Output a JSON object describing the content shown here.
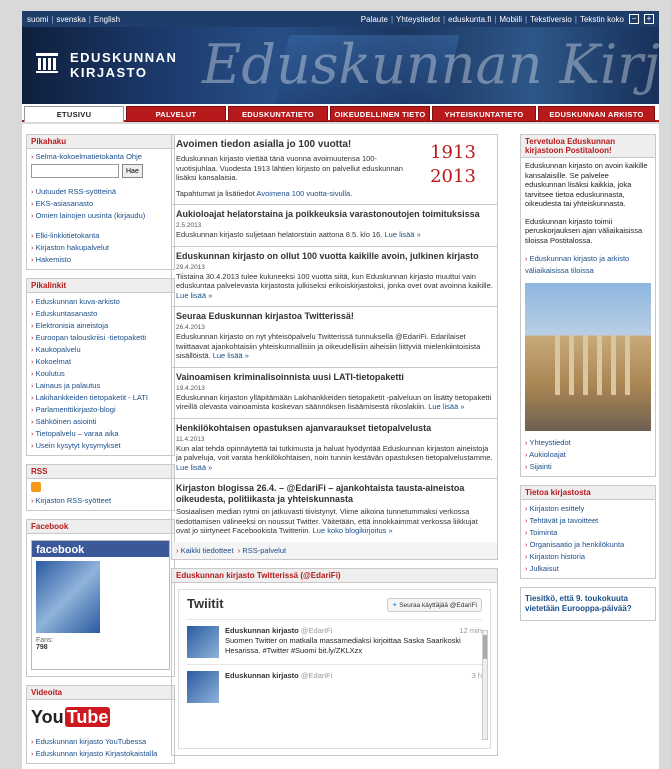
{
  "topbar": {
    "lang": [
      "suomi",
      "svenska",
      "English"
    ],
    "util": [
      "Palaute",
      "Yhteystiedot",
      "eduskunta.fi",
      "Mobiili",
      "Tekstiversio"
    ],
    "zoom_label": "Tekstin koko",
    "zoom_minus": "−",
    "zoom_plus": "+"
  },
  "banner": {
    "logo_line1": "EDUSKUNNAN",
    "logo_line2": "KIRJASTO",
    "script": "Eduskunnan Kirjasto"
  },
  "nav": [
    "ETUSIVU",
    "PALVELUT",
    "EDUSKUNTATIETO",
    "OIKEUDELLINEN TIETO",
    "YHTEISKUNTATIETO",
    "EDUSKUNNAN ARKISTO"
  ],
  "left": {
    "pikahaku": {
      "title": "Pikahaku",
      "link1": "Selma-kokoelmatietokanta",
      "link2": "Ohje",
      "button": "Hae",
      "links_a": [
        "Uutuudet RSS-syötteinä",
        "EKS-asiasanasto",
        "Omien lainojen uusinta (kirjaudu)"
      ],
      "links_b": [
        "Elki-linkkitietokanta",
        "Kirjaston hakupalvelut",
        "Hakemisto"
      ]
    },
    "pikalinkit": {
      "title": "Pikalinkit",
      "links": [
        "Eduskunnan kuva-arkisto",
        "Eduskuntasanasto",
        "Elektronisia aineistoja",
        "Euroopan talouskriisi -tietopaketti",
        "Kaukopalvelu",
        "Kokoelmat",
        "Koulutus",
        "Lainaus ja palautus",
        "Lakihankkeiden tietopaketit - LATI",
        "Parlamenttikirjasto-blogi",
        "Sähköinen asiointi",
        "Tietopalvelu – varaa aika",
        "Usein kysytyt kysymykset"
      ]
    },
    "rss": {
      "title": "RSS",
      "link": "Kirjaston RSS-syötteet"
    },
    "facebook": {
      "title": "Facebook",
      "brand": "facebook",
      "fans_label": "Fans",
      "fans": "798"
    },
    "videoita": {
      "title": "Videoita",
      "yt1": "You",
      "yt2": "Tube",
      "links": [
        "Eduskunnan kirjasto YouTubessa",
        "Eduskunnan kirjasto Kirjastokaistalla"
      ]
    }
  },
  "center": {
    "feature": {
      "title": "Avoimen tiedon asialla jo 100 vuotta!",
      "text": "Eduskunnan kirjasto viettää tänä vuonna avoimuutensa 100-vuotisjuhlaa. Vuodesta 1913 lähtien kirjasto on palvellut eduskunnan lisäksi kansalaisia.",
      "text2": "Tapahtumat ja lisätiedot",
      "link": "Avoimena 100 vuotta-sivulla",
      "year1": "1913",
      "year2": "2013"
    },
    "news": [
      {
        "title": "Aukioloajat helatorstaina ja poikkeuksia varastonoutojen toimituksissa",
        "date": "2.5.2013",
        "text": "Eduskunnan kirjasto suljetaan helatorstain aattona 8.5. klo 16.",
        "more": "Lue lisää »"
      },
      {
        "title": "Eduskunnan kirjasto on ollut 100 vuotta kaikille avoin, julkinen kirjasto",
        "date": "29.4.2013",
        "text": "Tiistaina 30.4.2013 tulee kuluneeksi 100 vuotta siitä, kun Eduskunnan kirjasto muuttui vain eduskuntaa palvelevasta kirjastosta julkiseksi erikoiskirjastoksi, jonka ovet ovat avoinna kaikille.",
        "more": "Lue lisää »"
      },
      {
        "title": "Seuraa Eduskunnan kirjastoa Twitterissä!",
        "date": "26.4.2013",
        "text": "Eduskunnan kirjasto on nyt yhteisöpalvelu Twitterissä tunnuksella @EdariFi. Edarilaiset twiittaavat ajankohtaisiin yhteiskunnallisiin ja oikeudellisiin aiheisiin liittyviä mielenkiintoisista sisällöistä.",
        "more": "Lue lisää »"
      },
      {
        "title": "Vainoamisen kriminalisoinnista uusi LATI-tietopaketti",
        "date": "19.4.2013",
        "text": "Eduskunnan kirjaston ylläpitämään Lakihankkeiden tietopaketit -palveluun on lisätty tietopaketti vireillä olevasta vainoamista koskevan säännöksen lisäämisestä rikoslakiin.",
        "more": "Lue lisää »"
      },
      {
        "title": "Henkilökohtaisen opastuksen ajanvaraukset tietopalvelusta",
        "date": "11.4.2013",
        "text": "Kun alat tehdä opinnäytettä tai tutkimusta ja haluat hyödyntää Eduskunnan kirjaston aineistoja ja palveluja, voit varata henkilökohtaisen, noin tunnin kestävän opastuksen tietopalvelustamme.",
        "more": "Lue lisää »"
      },
      {
        "title": "Kirjaston blogissa 26.4. – @EdariFi – ajankohtaista tausta-aineistoa oikeudesta, politiikasta ja yhteiskunnasta",
        "date": "",
        "text": "Sosiaalisen median rytmi on jatkuvasti tiivistynyt. Viime aikoina tunnetummaksi verkossa tiedottamisen välineeksi on noussut Twitter. Väitetään, että innokkaimmat verkossa liikkujat ovat jo siirtyneet Facebookista Twitteriin.",
        "more": "Lue koko blogikirjoitus »"
      }
    ],
    "foot_links": [
      "Kaikki tiedotteet",
      "RSS-palvelut"
    ],
    "twitter": {
      "header": "Eduskunnan kirjasto Twitterissä (@EdariFi)",
      "title": "Twiitit",
      "follow": "Seuraa käyttäjää @EdariFi",
      "tweets": [
        {
          "name": "Eduskunnan kirjasto",
          "handle": "@EdariFi",
          "time": "12 min",
          "text": "Suomen Twitter on matkalla massamediaksi kirjoittaa Saska Saarikoski Hesarissa. #Twitter #Suomi bit.ly/ZKLXzx"
        },
        {
          "name": "Eduskunnan kirjasto",
          "handle": "@EdariFi",
          "time": "3 h",
          "text": ""
        }
      ]
    }
  },
  "right": {
    "welcome": {
      "title": "Tervetuloa Eduskunnan kirjastoon Postitaloon!",
      "text1": "Eduskunnan kirjasto on avoin kaikille kansalaisille. Se palvelee eduskunnan lisäksi kaikkia, joka tarvitsee tietoa eduskunnasta, oikeudesta tai yhteiskunnasta.",
      "text2": "Eduskunnan kirjasto toimii peruskorjauksen ajan väliaikaisissa tiloissa Postitalossa.",
      "link": "Eduskunnan kirjasto ja arkisto väliaikaisissa tiloissa",
      "links": [
        "Yhteystiedot",
        "Aukioloajat",
        "Sijainti"
      ]
    },
    "tietoa": {
      "title": "Tietoa kirjastosta",
      "links": [
        "Kirjaston esittely",
        "Tehtävät ja tavoitteet",
        "Toiminta",
        "Organisaatio ja henkilökunta",
        "Kirjaston historia",
        "Julkaisut"
      ]
    },
    "tiesitko": {
      "title": "Tiesitkö, että 9. toukokuuta vietetään Eurooppa-päivää?"
    }
  }
}
